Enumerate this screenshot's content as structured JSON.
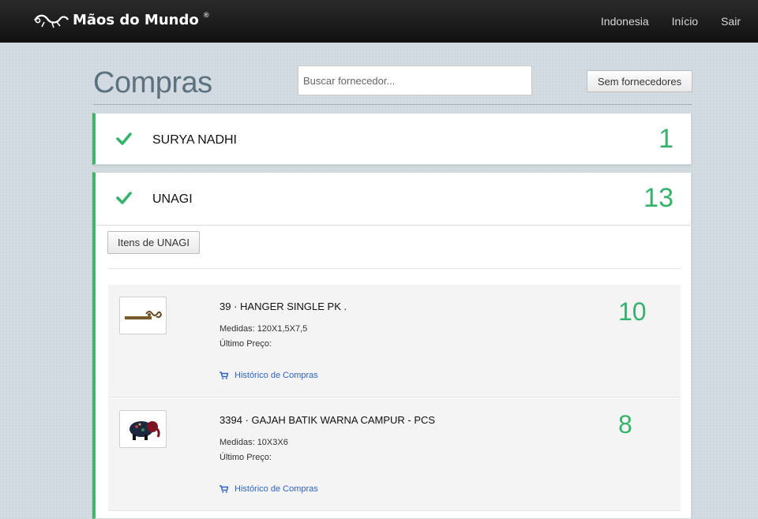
{
  "navbar": {
    "logo_text": "Mãos do Mundo",
    "logo_mark": "®",
    "links": [
      "Indonesia",
      "Início",
      "Sair"
    ]
  },
  "page": {
    "title": "Compras",
    "search_placeholder": "Buscar fornecedor...",
    "no_supplier_label": "Sem fornecedores"
  },
  "suppliers": [
    {
      "name": "SURYA NADHI",
      "count": "1"
    },
    {
      "name": "UNAGI",
      "count": "13",
      "items_button": "Itens de UNAGI",
      "items": [
        {
          "title": "39 · HANGER SINGLE PK .",
          "measures": "Medidas: 120X1,5X7,5",
          "last_price": "Último Preço:",
          "history": "Histórico de Compras",
          "qty": "10"
        },
        {
          "title": "3394 · GAJAH BATIK WARNA CAMPUR - PCS",
          "measures": "Medidas: 10X3X6",
          "last_price": "Último Preço:",
          "history": "Histórico de Compras",
          "qty": "8"
        }
      ]
    }
  ],
  "colors": {
    "accent_green": "#34b36a",
    "link_blue": "#2f64c4",
    "title_gray": "#5d7180"
  }
}
